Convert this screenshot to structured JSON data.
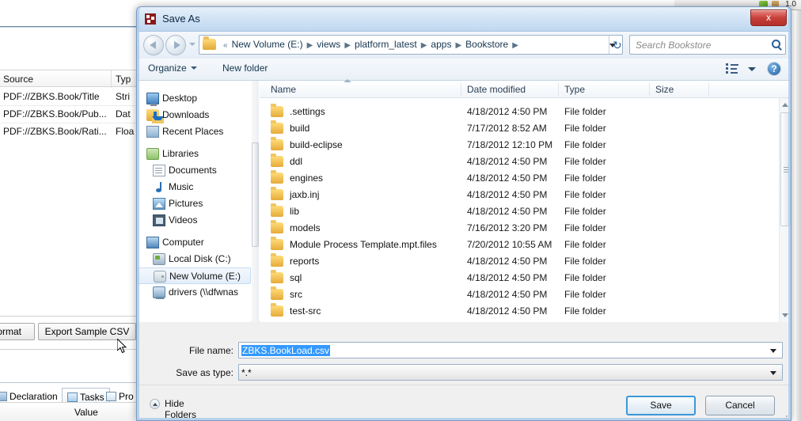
{
  "background": {
    "table": {
      "columns": [
        "Source",
        "Typ"
      ],
      "rows": [
        {
          "source": "PDF://ZBKS.Book/Title",
          "type": "Stri"
        },
        {
          "source": "PDF://ZBKS.Book/Pub...",
          "type": "Dat"
        },
        {
          "source": "PDF://ZBKS.Book/Rati...",
          "type": "Floa"
        }
      ]
    },
    "buttons": [
      {
        "label": "Format"
      },
      {
        "label": "Export Sample CSV"
      }
    ],
    "tabs": [
      {
        "label": "Declaration",
        "active": false
      },
      {
        "label": "Tasks",
        "active": true
      },
      {
        "label": "Pro",
        "active": false
      }
    ],
    "value_header": "Value",
    "toolbar_fragment": "1.0"
  },
  "dialog": {
    "title": "Save As",
    "close_label": "x",
    "address": {
      "crumbs": [
        "New Volume (E:)",
        "views",
        "platform_latest",
        "apps",
        "Bookstore"
      ],
      "overflow": "«",
      "dropdown_icon": "chevron-down-icon",
      "refresh_icon": "refresh-icon"
    },
    "search": {
      "placeholder": "Search Bookstore"
    },
    "commandbar": {
      "organize": "Organize",
      "new_folder": "New folder",
      "view_icon": "view-list-icon",
      "help_icon": "help-icon"
    },
    "nav_pane": {
      "items": [
        {
          "label": "Desktop",
          "icon": "monitor-icon",
          "indent": false,
          "selected": false
        },
        {
          "label": "Downloads",
          "icon": "downloads-folder-icon",
          "indent": false,
          "selected": false
        },
        {
          "label": "Recent Places",
          "icon": "recent-places-icon",
          "indent": false,
          "selected": false
        },
        {
          "label": "Libraries",
          "icon": "libraries-icon",
          "indent": false,
          "selected": false
        },
        {
          "label": "Documents",
          "icon": "documents-icon",
          "indent": true,
          "selected": false
        },
        {
          "label": "Music",
          "icon": "music-icon",
          "indent": true,
          "selected": false
        },
        {
          "label": "Pictures",
          "icon": "pictures-icon",
          "indent": true,
          "selected": false
        },
        {
          "label": "Videos",
          "icon": "videos-icon",
          "indent": true,
          "selected": false
        },
        {
          "label": "Computer",
          "icon": "computer-icon",
          "indent": false,
          "selected": false
        },
        {
          "label": "Local Disk (C:)",
          "icon": "local-disk-icon",
          "indent": true,
          "selected": false
        },
        {
          "label": "New Volume (E:)",
          "icon": "drive-icon",
          "indent": true,
          "selected": true
        },
        {
          "label": "drivers (\\\\dfwnas",
          "icon": "network-drive-icon",
          "indent": true,
          "selected": false
        }
      ]
    },
    "file_list": {
      "columns": [
        "Name",
        "Date modified",
        "Type",
        "Size"
      ],
      "rows": [
        {
          "name": ".settings",
          "date": "4/18/2012 4:50 PM",
          "type": "File folder",
          "size": ""
        },
        {
          "name": "build",
          "date": "7/17/2012 8:52 AM",
          "type": "File folder",
          "size": ""
        },
        {
          "name": "build-eclipse",
          "date": "7/18/2012 12:10 PM",
          "type": "File folder",
          "size": ""
        },
        {
          "name": "ddl",
          "date": "4/18/2012 4:50 PM",
          "type": "File folder",
          "size": ""
        },
        {
          "name": "engines",
          "date": "4/18/2012 4:50 PM",
          "type": "File folder",
          "size": ""
        },
        {
          "name": "jaxb.inj",
          "date": "4/18/2012 4:50 PM",
          "type": "File folder",
          "size": ""
        },
        {
          "name": "lib",
          "date": "4/18/2012 4:50 PM",
          "type": "File folder",
          "size": ""
        },
        {
          "name": "models",
          "date": "7/16/2012 3:20 PM",
          "type": "File folder",
          "size": ""
        },
        {
          "name": "Module Process Template.mpt.files",
          "date": "7/20/2012 10:55 AM",
          "type": "File folder",
          "size": ""
        },
        {
          "name": "reports",
          "date": "4/18/2012 4:50 PM",
          "type": "File folder",
          "size": ""
        },
        {
          "name": "sql",
          "date": "4/18/2012 4:50 PM",
          "type": "File folder",
          "size": ""
        },
        {
          "name": "src",
          "date": "4/18/2012 4:50 PM",
          "type": "File folder",
          "size": ""
        },
        {
          "name": "test-src",
          "date": "4/18/2012 4:50 PM",
          "type": "File folder",
          "size": ""
        }
      ]
    },
    "form": {
      "file_name_label": "File name:",
      "file_name_value": "ZBKS.BookLoad.csv",
      "save_type_label": "Save as type:",
      "save_type_value": "*.*"
    },
    "footer": {
      "hide_folders": "Hide Folders",
      "save": "Save",
      "cancel": "Cancel"
    }
  }
}
